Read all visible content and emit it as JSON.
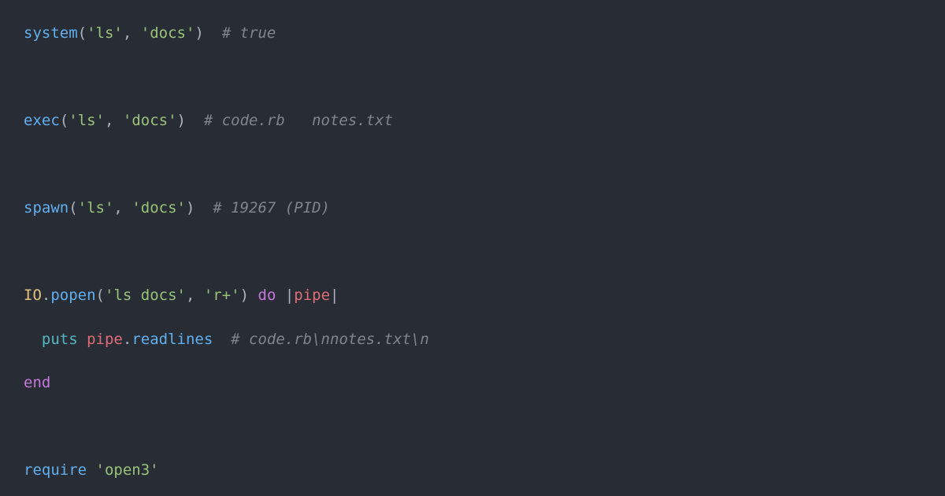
{
  "lines": {
    "l1": {
      "fn": "system",
      "p1": "(",
      "s1": "'ls'",
      "c1": ", ",
      "s2": "'docs'",
      "p2": ")  ",
      "comment": "# true"
    },
    "l2": {
      "fn": "exec",
      "p1": "(",
      "s1": "'ls'",
      "c1": ", ",
      "s2": "'docs'",
      "p2": ")  ",
      "comment": "# code.rb   notes.txt"
    },
    "l3": {
      "fn": "spawn",
      "p1": "(",
      "s1": "'ls'",
      "c1": ", ",
      "s2": "'docs'",
      "p2": ")  ",
      "comment": "# 19267 (PID)"
    },
    "l4": {
      "const": "IO",
      "dot": ".",
      "fn": "popen",
      "p1": "(",
      "s1": "'ls docs'",
      "c1": ", ",
      "s2": "'r+'",
      "p2": ") ",
      "kw": "do",
      "bar1": " |",
      "param": "pipe",
      "bar2": "|"
    },
    "l5": {
      "indent": "  ",
      "puts": "puts",
      "sp": " ",
      "ident": "pipe",
      "dot": ".",
      "method": "readlines",
      "sp2": "  ",
      "comment": "# code.rb\\nnotes.txt\\n"
    },
    "l6": {
      "kw": "end"
    },
    "l7": {
      "fn": "require",
      "sp": " ",
      "s1": "'open3'"
    }
  }
}
